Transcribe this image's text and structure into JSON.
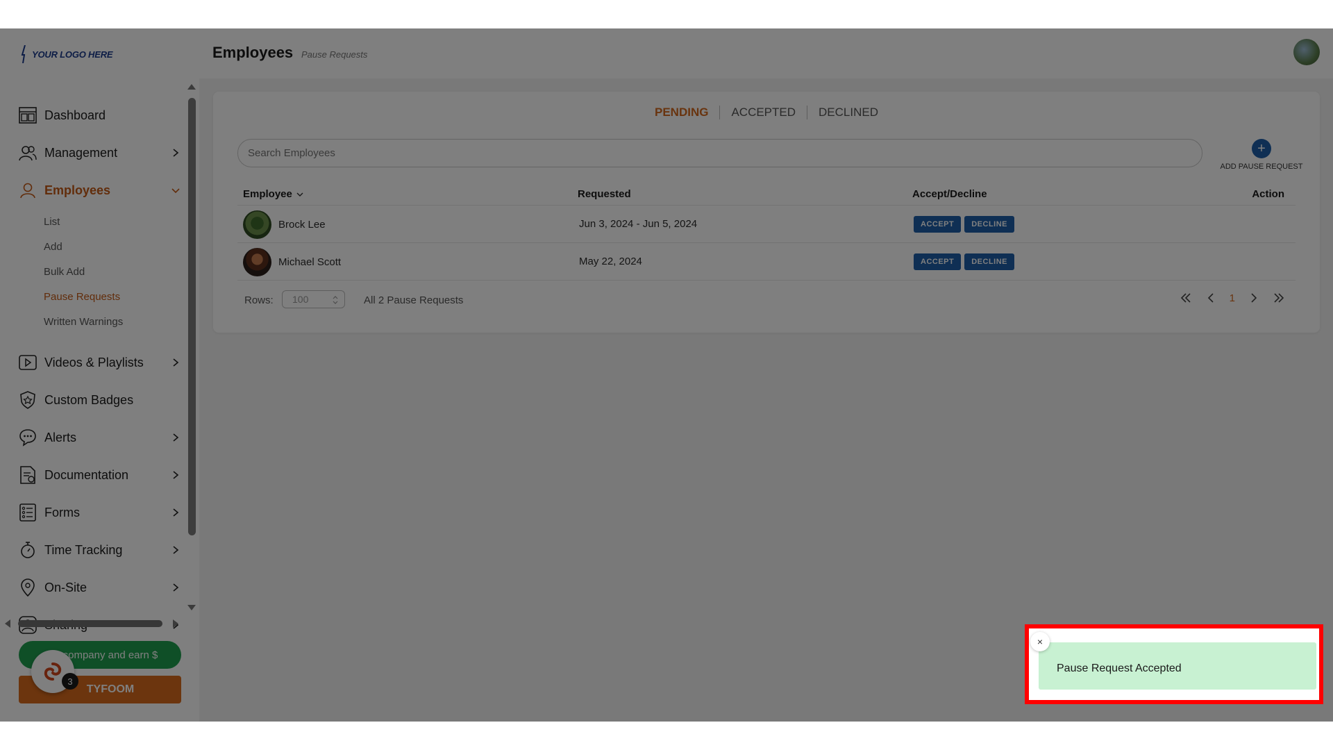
{
  "logo": {
    "text": "YOUR LOGO HERE"
  },
  "header": {
    "title": "Employees",
    "subtitle": "Pause Requests"
  },
  "sidebar": {
    "items": [
      {
        "label": "Dashboard",
        "icon": "dashboard-icon",
        "chevron": false
      },
      {
        "label": "Management",
        "icon": "management-icon",
        "chevron": true
      },
      {
        "label": "Employees",
        "icon": "employee-icon",
        "chevron": true,
        "active": true
      },
      {
        "label": "Videos & Playlists",
        "icon": "video-icon",
        "chevron": true
      },
      {
        "label": "Custom Badges",
        "icon": "badge-icon",
        "chevron": false
      },
      {
        "label": "Alerts",
        "icon": "alert-icon",
        "chevron": true
      },
      {
        "label": "Documentation",
        "icon": "documentation-icon",
        "chevron": true
      },
      {
        "label": "Forms",
        "icon": "forms-icon",
        "chevron": true
      },
      {
        "label": "Time Tracking",
        "icon": "stopwatch-icon",
        "chevron": true
      },
      {
        "label": "On-Site",
        "icon": "location-pin-icon",
        "chevron": true
      },
      {
        "label": "Sharing",
        "icon": "sharing-icon",
        "chevron": true
      }
    ],
    "employee_sub": [
      "List",
      "Add",
      "Bulk Add",
      "Pause Requests",
      "Written Warnings"
    ],
    "refer_label": "Refer a company and earn $",
    "refer_visible": "company and earn $",
    "tyfoom_label": "TYFOOM",
    "chat_badge": "3"
  },
  "tabs": [
    {
      "label": "PENDING",
      "active": true
    },
    {
      "label": "ACCEPTED",
      "active": false
    },
    {
      "label": "DECLINED",
      "active": false
    }
  ],
  "search": {
    "placeholder": "Search Employees"
  },
  "add_button": {
    "label": "ADD PAUSE REQUEST"
  },
  "table": {
    "columns": {
      "employee": "Employee",
      "requested": "Requested",
      "accept_decline": "Accept/Decline",
      "action": "Action"
    },
    "rows": [
      {
        "name": "Brock Lee",
        "requested": "Jun 3, 2024 - Jun 5, 2024"
      },
      {
        "name": "Michael Scott",
        "requested": "May 22, 2024"
      }
    ],
    "accept_label": "ACCEPT",
    "decline_label": "DECLINE"
  },
  "footer": {
    "rows_label": "Rows:",
    "rows_value": "100",
    "total": "All 2 Pause Requests",
    "page": "1"
  },
  "toast": {
    "message": "Pause Request Accepted",
    "close": "×"
  },
  "colors": {
    "accent": "#d2691e",
    "primary": "#1e5fa8",
    "success_bg": "#c8f1d2",
    "highlight": "#ff0000"
  }
}
